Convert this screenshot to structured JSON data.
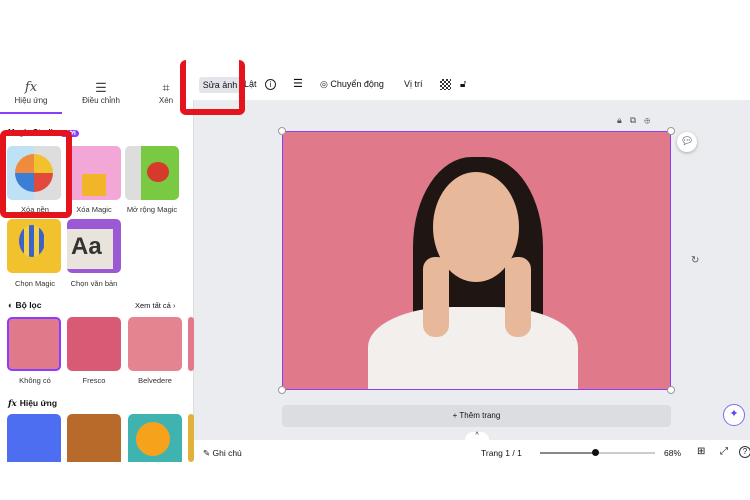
{
  "left_tabs": [
    {
      "label": "Hiệu ứng",
      "icon": "fx-icon"
    },
    {
      "label": "Điều chỉnh",
      "icon": "sliders-icon"
    },
    {
      "label": "Xén",
      "icon": "crop-icon"
    }
  ],
  "toolbar": {
    "edit_photo": "Sửa ảnh",
    "flip": "Lật",
    "animate": "Chuyển động",
    "position": "Vị trí"
  },
  "magic_studio": {
    "title": "Magic Studio",
    "badge": "Mới",
    "items": [
      "Xóa nền",
      "Xóa Magic",
      "Mở rộng Magic",
      "Chọn Magic",
      "Chọn văn bản"
    ]
  },
  "filters": {
    "title": "Bộ lọc",
    "see_all": "Xem tất cả",
    "items": [
      "Không có",
      "Fresco",
      "Belvedere"
    ]
  },
  "effects": {
    "title": "Hiệu ứng"
  },
  "canvas": {
    "add_page": "+ Thêm trang"
  },
  "footer": {
    "notes": "Ghi chú",
    "page": "Trang 1 / 1",
    "zoom": "68%",
    "zoom_fraction": 0.48
  },
  "colors": {
    "accent": "#8b3dff",
    "highlight": "#e3141b",
    "canvas_bg": "#ebecf0",
    "photo_bg": "#e07a8a"
  }
}
